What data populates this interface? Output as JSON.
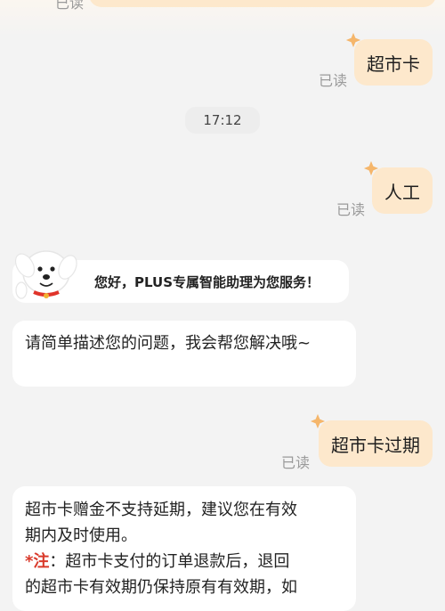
{
  "header_cut": {
    "read_label": "已读"
  },
  "messages": [
    {
      "type": "user",
      "text": "超市卡",
      "read": "已读"
    },
    {
      "type": "time",
      "text": "17:12"
    },
    {
      "type": "user",
      "text": "人工",
      "read": "已读"
    },
    {
      "type": "bot_banner",
      "text": "您好，PLUS专属智能助理为您服务！"
    },
    {
      "type": "bot",
      "text": "请简单描述您的问题，我会帮您解决哦~"
    },
    {
      "type": "user",
      "text": "超市卡过期",
      "read": "已读"
    },
    {
      "type": "bot",
      "line1": "超市卡赠金不支持延期，建议您在有效",
      "line2": "期内及时使用。",
      "note_label": "*注",
      "line3": "：超市卡支付的订单退款后，退回",
      "line4": "的超市卡有效期仍保持原有有效期，如"
    }
  ],
  "colors": {
    "user_bubble": "#fde8cc",
    "bot_bubble": "#ffffff",
    "background": "#f3f3f3",
    "note_red": "#d93a2b"
  },
  "icons": {
    "mascot": "jd-dog-mascot-icon",
    "star": "star-icon"
  }
}
